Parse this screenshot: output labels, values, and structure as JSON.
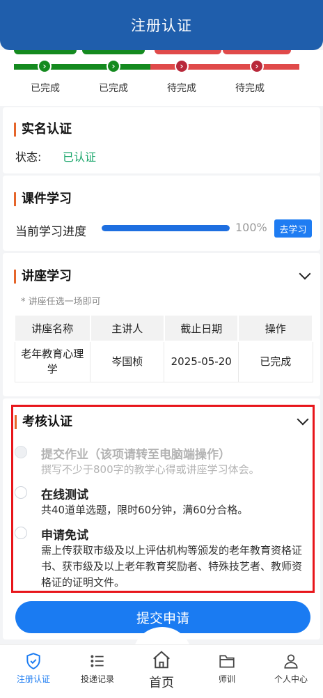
{
  "header": {
    "title": "注册认证"
  },
  "progress": {
    "steps": [
      {
        "label": "已完成",
        "state": "done"
      },
      {
        "label": "已完成",
        "state": "done"
      },
      {
        "label": "待完成",
        "state": "todo"
      },
      {
        "label": "待完成",
        "state": "todo"
      }
    ],
    "colors": {
      "done": "#148a1f",
      "todo": "#e04a4a"
    }
  },
  "realname": {
    "title": "实名认证",
    "status_label": "状态:",
    "status_value": "已认证"
  },
  "course": {
    "title": "课件学习",
    "progress_label": "当前学习进度",
    "progress_value": 1.0,
    "progress_text": "100%",
    "button": "去学习"
  },
  "lecture": {
    "title": "讲座学习",
    "note": "* 讲座任选一场即可",
    "columns": [
      "讲座名称",
      "主讲人",
      "截止日期",
      "操作"
    ],
    "rows": [
      [
        "老年教育心理学",
        "岑国桢",
        "2025-05-20",
        "已完成"
      ]
    ]
  },
  "exam": {
    "title": "考核认证",
    "options": [
      {
        "title": "提交作业（该项请转至电脑端操作）",
        "desc": "撰写不少于800字的教学心得或讲座学习体会。",
        "disabled": true
      },
      {
        "title": "在线测试",
        "desc": "共40道单选题，限时60分钟，满60分合格。",
        "disabled": false
      },
      {
        "title": "申请免试",
        "desc": "需上传获取市级及以上评估机构等颁发的老年教育资格证书、获市级及以上老年教育奖励者、特殊技艺者、教师资格证的证明文件。",
        "disabled": false
      }
    ]
  },
  "submit_label": "提交申请",
  "tabbar": {
    "items": [
      {
        "label": "注册认证",
        "icon": "shield-check-icon",
        "active": true
      },
      {
        "label": "投递记录",
        "icon": "list-icon",
        "active": false
      },
      {
        "label": "首页",
        "icon": "home-icon",
        "active": false
      },
      {
        "label": "师训",
        "icon": "folder-icon",
        "active": false
      },
      {
        "label": "个人中心",
        "icon": "user-icon",
        "active": false
      }
    ]
  }
}
